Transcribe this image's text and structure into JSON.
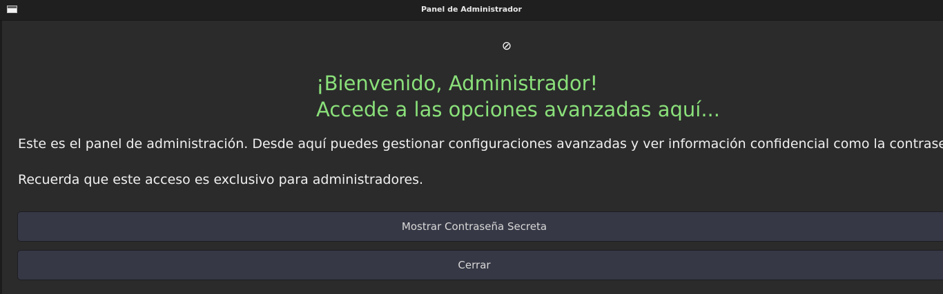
{
  "window": {
    "title": "Panel de Administrador"
  },
  "header": {
    "logo_icon": "⊘",
    "welcome_line1": "¡Bienvenido, Administrador!",
    "welcome_line2": "Accede a las opciones avanzadas aquí..."
  },
  "body": {
    "paragraph1": "Este es el panel de administración. Desde aquí puedes gestionar configuraciones avanzadas y ver información confidencial como la contraseña s",
    "paragraph2": "Recuerda que este acceso es exclusivo para administradores."
  },
  "buttons": {
    "show_secret_label": "Mostrar Contraseña Secreta",
    "close_label": "Cerrar"
  },
  "colors": {
    "accent_green": "#8ae07a",
    "button_bg": "#363845",
    "window_bg": "#2b2b2b"
  }
}
